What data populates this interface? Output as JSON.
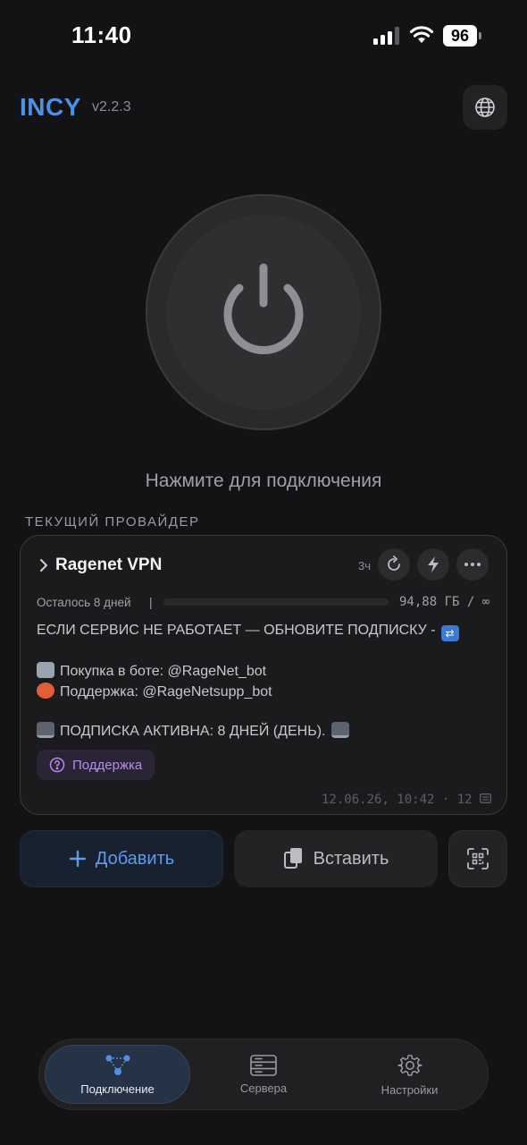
{
  "status_bar": {
    "time": "11:40",
    "battery": "96"
  },
  "header": {
    "brand": "INCY",
    "version": "v2.2.3",
    "globe_icon": "globe-icon"
  },
  "power": {
    "hint": "Нажмите для подключения"
  },
  "provider_section": {
    "title": "ТЕКУЩИЙ ПРОВАЙДЕР"
  },
  "provider": {
    "name": "Ragenet VPN",
    "age": "3ч",
    "remaining": "Осталось 8 дней",
    "separator": "|",
    "traffic": "94,88 ГБ / ∞",
    "message_line1": "ЕСЛИ СЕРВИС НЕ РАБОТАЕТ — ОБНОВИТЕ ПОДПИСКУ -",
    "message_line2": "Покупка в боте: @RageNet_bot",
    "message_line3": "Поддержка: @RageNetsupp_bot",
    "message_line4": "ПОДПИСКА АКТИВНА: 8 ДНЕЙ (ДЕНЬ).",
    "support_label": "Поддержка",
    "footer": "12.06.26, 10:42 · 12"
  },
  "actions": {
    "add_label": "Добавить",
    "paste_label": "Вставить"
  },
  "tabs": [
    {
      "label": "Подключение",
      "icon": "nodes-icon",
      "active": true
    },
    {
      "label": "Сервера",
      "icon": "server-icon",
      "active": false
    },
    {
      "label": "Настройки",
      "icon": "gear-icon",
      "active": false
    }
  ],
  "colors": {
    "accent": "#4f8fe8",
    "support": "#b48cf0",
    "background": "#131315"
  }
}
